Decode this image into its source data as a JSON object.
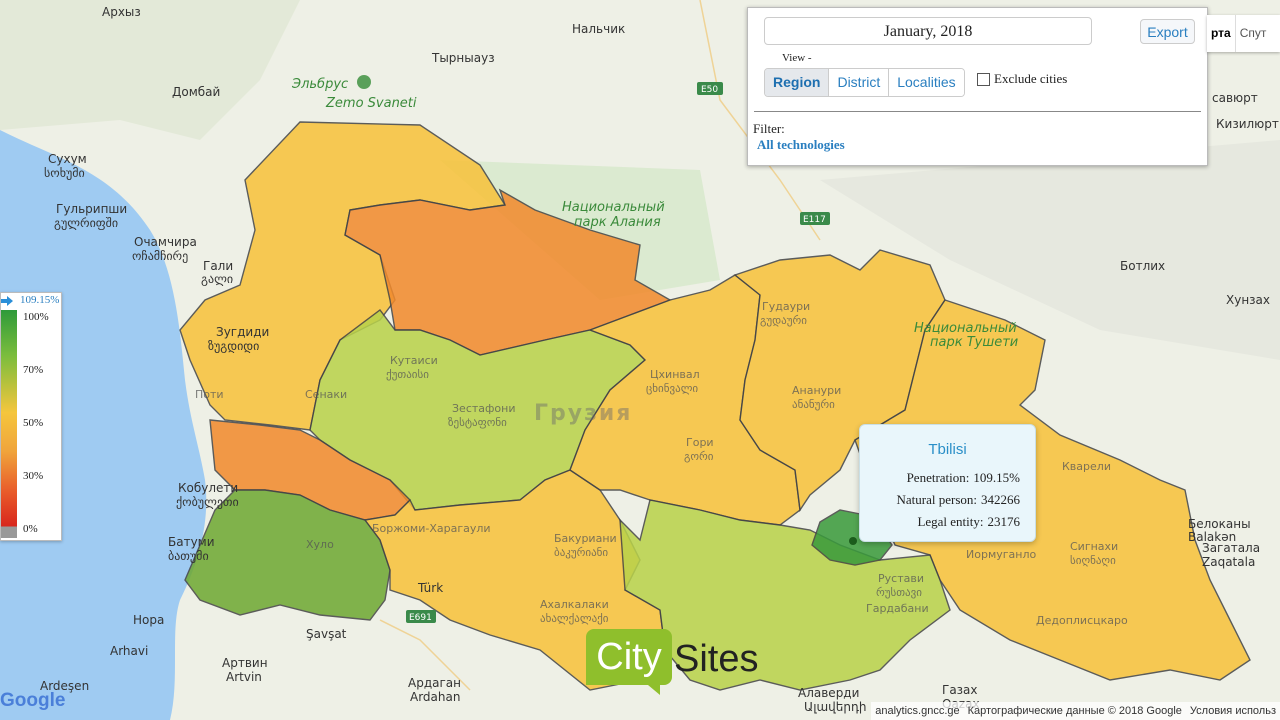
{
  "panel": {
    "date": "January, 2018",
    "export_label": "Export",
    "view_label": "View -",
    "view_tabs": [
      {
        "label": "Region",
        "active": true
      },
      {
        "label": "District",
        "active": false
      },
      {
        "label": "Localities",
        "active": false
      }
    ],
    "exclude_cities_label": "Exclude cities",
    "exclude_cities_checked": false,
    "filter_label": "Filter:",
    "filter_value": "All technologies"
  },
  "map_type": {
    "map": "рта",
    "satellite": "Спут"
  },
  "legend": {
    "current_value": "109.15%",
    "ticks": [
      "100%",
      "70%",
      "50%",
      "30%",
      "0%"
    ]
  },
  "tooltip": {
    "title": "Tbilisi",
    "rows": [
      {
        "label": "Penetration:",
        "value": "109.15%"
      },
      {
        "label": "Natural person:",
        "value": "342266"
      },
      {
        "label": "Legal entity:",
        "value": "23176"
      }
    ]
  },
  "logo": {
    "city": "City",
    "sites": "Sites"
  },
  "footer": {
    "google": "Google",
    "site": "analytics.gncc.ge",
    "attribution": "Картографические данные © 2018 Google",
    "terms": "Условия использ"
  },
  "map_labels": {
    "arhyz": "Архыз",
    "nalchik": "Нальчик",
    "elbrus": "Эльбрус",
    "tyrnyauz": "Тырныауз",
    "dombay": "Домбай",
    "zemo_svaneti": "Zemo Svaneti",
    "sukhum": "Сухум",
    "sukhum_ka": "სოხუმი",
    "gulripshi": "Гульрипши",
    "gulripshi_ka": "გულრიფში",
    "ochamchira": "Очамчира",
    "ochamchira_ka": "ოჩამჩირე",
    "gali": "Гали",
    "gali_ka": "გალი",
    "zugdidi": "Зугдиди",
    "zugdidi_ka": "ზუგდიდი",
    "poti": "Поти",
    "senaki": "Сенаки",
    "kobuleti": "Кобулети",
    "kobuleti_ka": "ქობულეთი",
    "batumi": "Батуми",
    "batumi_ka": "ბათუმი",
    "khulo": "Хуло",
    "nora": "Нора",
    "arhavi": "Arhavi",
    "artvin": "Артвин",
    "artvin_lat": "Artvin",
    "ardeshen": "Ardeşen",
    "savsat": "Şavşat",
    "turkey": "Türk",
    "ardahan": "Ардаган",
    "ardahan_lat": "Ardahan",
    "kutaisi": "Кутаиси",
    "kutaisi_ka": "ქუთაისი",
    "zestafoni": "Зестафони",
    "zestafoni_ka": "ზესტაფონი",
    "georgia": "Грузия",
    "national_park_alania": "Национальный",
    "national_park_alania2": "парк Алания",
    "tskhinval": "Цхинвал",
    "tskhinval_ka": "ცხინვალი",
    "gori": "Гори",
    "gori_ka": "გორი",
    "borjomi": "Боржоми-Харагаули",
    "bakuriani": "Бакуриани",
    "bakuriani_ka": "ბაკურიანი",
    "akhalkalaki": "Ахалкалаки",
    "akhalkalaki_ka": "ახალქალაქი",
    "gudauri": "Гудаури",
    "gudauri_ka": "გუდაური",
    "ananuri": "Ананури",
    "ananuri_ka": "ანანური",
    "tusheti": "Национальный",
    "tusheti2": "парк Тушети",
    "kvareli": "Кварели",
    "rustavi": "Рустави",
    "rustavi_ka": "რუსთავი",
    "gardabani": "Гардабани",
    "sighnaghi": "Сигнахи",
    "sighnaghi_ka": "სიღნაღი",
    "iormughanlo": "Иормуганло",
    "dedoplistskaro": "Дедоплисцкаро",
    "belokany": "Белоканы",
    "balakan": "Balakən",
    "zagatala": "Загатала",
    "zaqatala": "Zaqatala",
    "botlikh": "Ботлих",
    "khunzakh": "Хунзах",
    "khasavyurt": "савюрт",
    "kizilyurt": "Кизилюрт",
    "alaverdi": "Алаверди",
    "alaverdi_am": "Ալավերդի",
    "kazakh": "Газах",
    "qazax": "Qazax",
    "e50": "E50",
    "e117": "E117",
    "e691": "E691"
  },
  "colors": {
    "green_dark": "#2e9a3a",
    "green": "#8fbf3c",
    "yellow": "#f8c23a",
    "orange": "#f28a2c",
    "olive": "#6ea832",
    "water": "#9fcbf2"
  }
}
